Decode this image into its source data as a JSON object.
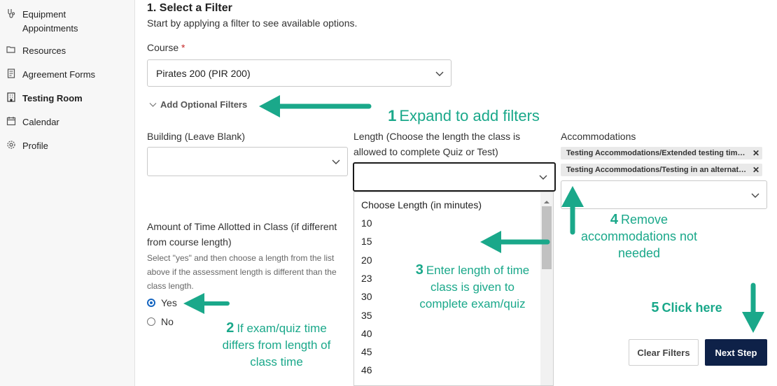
{
  "sidebar": {
    "items": [
      {
        "label": "Equipment Appointments",
        "icon": "equipment-icon"
      },
      {
        "label": "Resources",
        "icon": "folder-icon"
      },
      {
        "label": "Agreement Forms",
        "icon": "document-icon"
      },
      {
        "label": "Testing Room",
        "icon": "building-icon",
        "active": true
      },
      {
        "label": "Calendar",
        "icon": "calendar-icon"
      },
      {
        "label": "Profile",
        "icon": "gear-icon"
      }
    ]
  },
  "step": {
    "title": "1. Select a Filter",
    "subtitle": "Start by applying a filter to see available options."
  },
  "course": {
    "label": "Course",
    "required_mark": "*",
    "value": "Pirates 200 (PIR 200)"
  },
  "optional_filters": {
    "label": "Add Optional Filters"
  },
  "building": {
    "label": "Building (Leave Blank)",
    "value": ""
  },
  "length": {
    "label": "Length (Choose the length the class is allowed to complete Quiz or Test)",
    "value": "",
    "options": [
      "Choose Length (in minutes)",
      "10",
      "15",
      "20",
      "23",
      "30",
      "35",
      "40",
      "45",
      "46"
    ]
  },
  "accommodations": {
    "label": "Accommodations",
    "chips": [
      "Testing Accommodations/Extended testing time o...",
      "Testing Accommodations/Testing in an alternative..."
    ]
  },
  "time_allotted": {
    "label": "Amount of Time Allotted in Class (if different from course length)",
    "help": "Select \"yes\" and then choose a length from the list above if the assessment length is different than the class length.",
    "options": [
      {
        "label": "Yes",
        "checked": true
      },
      {
        "label": "No",
        "checked": false
      }
    ]
  },
  "buttons": {
    "clear": "Clear Filters",
    "next": "Next Step"
  },
  "annotations": {
    "a1": {
      "num": "1",
      "text": "Expand to add filters"
    },
    "a2": {
      "num": "2",
      "text": "If exam/quiz time differs from length of class time"
    },
    "a3": {
      "num": "3",
      "text": "Enter length of time class is given to complete exam/quiz"
    },
    "a4": {
      "num": "4",
      "text": "Remove accommodations not needed"
    },
    "a5": {
      "num": "5",
      "text": "Click here"
    }
  },
  "colors": {
    "annotation": "#1aa88a",
    "primary_button": "#0e2148",
    "radio_checked": "#1565c0",
    "required": "#c62828"
  }
}
